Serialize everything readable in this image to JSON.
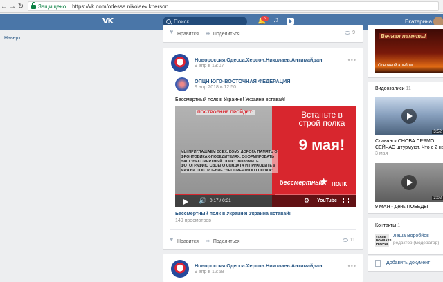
{
  "browser": {
    "secure_label": "Защищено",
    "url": "https://vk.com/odessa.nikolaev.kherson"
  },
  "header": {
    "search_placeholder": "Поиск",
    "notification_count": "5",
    "user_name": "Екатерина"
  },
  "left": {
    "link": "Наверх"
  },
  "post_top_actions": {
    "like_label": "Нравится",
    "share_label": "Поделиться",
    "views": "9"
  },
  "post_main": {
    "author": "Новороссия.Одесса.Херсон.Николаев.Антимайдан",
    "date": "9 апр в 13:07",
    "repost_author": "ОПЦН ЮГО-ВОСТОЧНАЯ ФЕДЕРАЦИЯ",
    "repost_date": "9 апр 2018 в 12:50",
    "text": "Бессмертный полк в Украине! Украина вставай!",
    "video": {
      "header": "ПОСТРОЕНИЕ ПРОЙДЕТ:",
      "body": "МЫ ПРИГЛАШАЕМ ВСЕХ, КОМУ ДОРОГА ПАМЯТЬ О ФРОНТОВИКАХ-ПОБЕДИТЕЛЯХ, СФОРМИРОВАТЬ НАШ \"БЕССМЕРТНЫЙ ПОЛК\". ВОЗЬМИТЕ ФОТОГРАФИЮ СВОЕГО СОЛДАТА И ПРИХОДИТЕ 9 МАЯ НА ПОСТРОЕНИЕ \"БЕССМЕРТНОГО ПОЛКА\"",
      "title_line1": "Встаньте в строй полка",
      "title_line2": "9 мая!",
      "logo_text": "бессмертный",
      "logo_polk": "ПОЛК",
      "time": "0:17 / 0:31",
      "progress": 0.55,
      "platform": "YouTube"
    },
    "caption": "Бессмертный полк в Украине! Украина вставай!",
    "views_label": "149 просмотров",
    "like_label": "Нравится",
    "share_label": "Поделиться",
    "views": "11"
  },
  "post_next": {
    "author": "Новороссия.Одесса.Херсон.Николаев.Антимайдан",
    "date": "9 апр в 12:58"
  },
  "sidebar": {
    "album_title": "Вечная память!",
    "album_label": "Основной альбом",
    "videos_title": "Видеозаписи",
    "videos_count": "11",
    "video1": {
      "title": "Славянск СНОВА ПРЯМО СЕЙЧАС штурмуют. Что с 2 на",
      "duration": "3:52",
      "date": "3 мая"
    },
    "video2": {
      "title": "9 МАЯ - День ПОБЕДЫ",
      "duration": "3:02"
    },
    "contacts_title": "Контакты",
    "contacts_count": "1",
    "contact_avatar_text": "#SAVE DONBASS PEOPLE",
    "contact_name": "Лёша Воробйов",
    "contact_role": "редактор (модератор)",
    "add_document": "Добавить документ"
  },
  "colors": {
    "vk_header": "#4a76a8",
    "link": "#2a5885",
    "video_red": "#d8262e"
  }
}
